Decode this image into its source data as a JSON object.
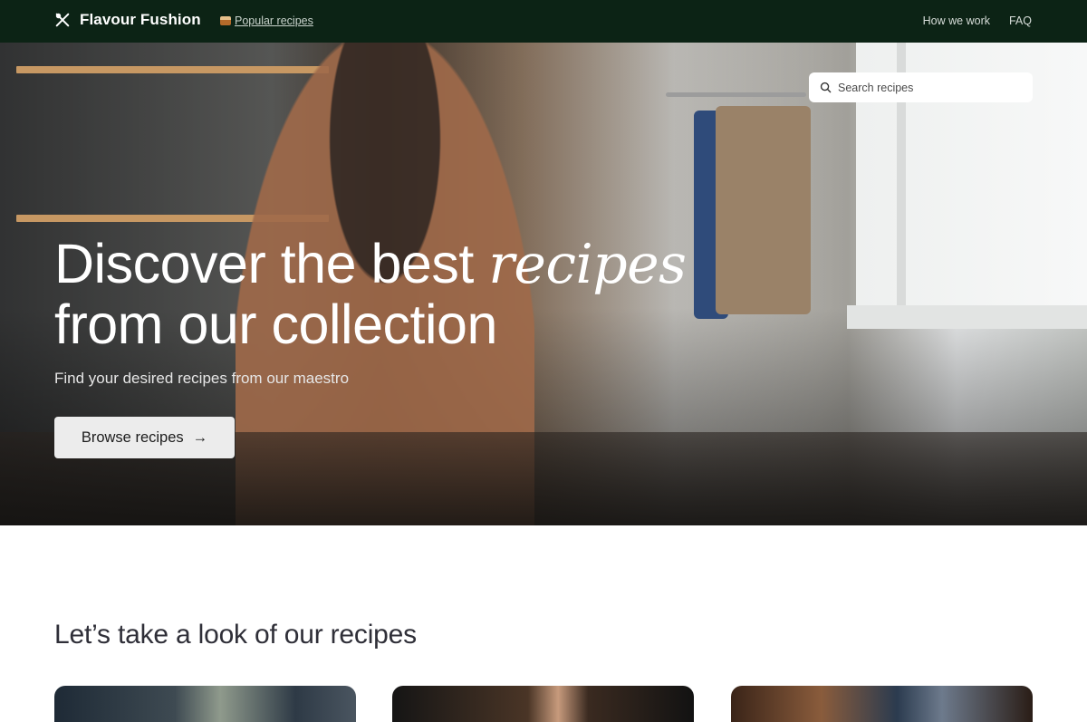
{
  "nav": {
    "brand": "Flavour Fushion",
    "brand_icon": "utensils-icon",
    "popular_link": "Popular recipes",
    "links": [
      "How we work",
      "FAQ"
    ]
  },
  "hero": {
    "search_placeholder": "Search recipes",
    "headline_line1": "Discover the best ",
    "headline_accent": "recipes",
    "headline_line2": "from our collection",
    "subtitle": "Find your desired recipes from our maestro",
    "cta_label": "Browse recipes",
    "cta_arrow": "→"
  },
  "section": {
    "title": "Let’s take a look of our recipes"
  },
  "colors": {
    "nav_bg": "#0c2315",
    "cta_bg": "#ececec"
  }
}
